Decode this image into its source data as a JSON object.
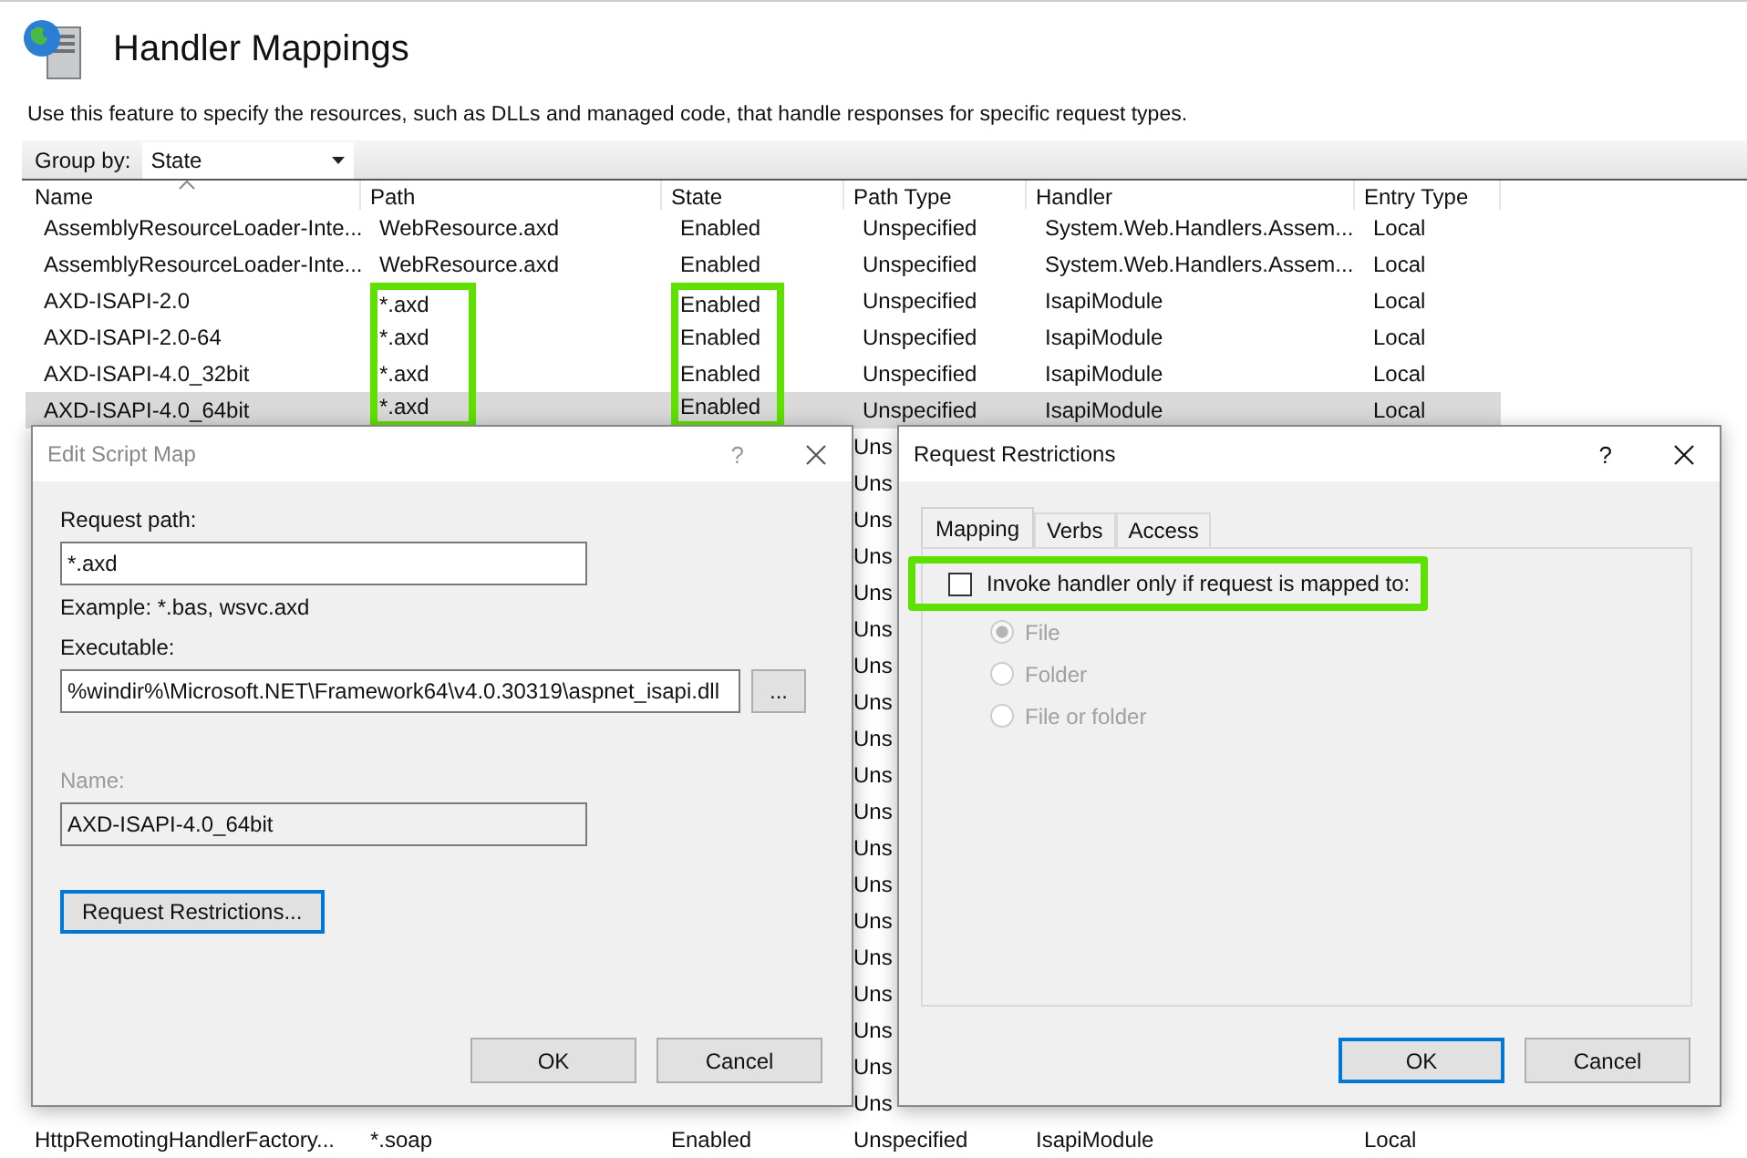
{
  "header": {
    "title": "Handler Mappings",
    "description": "Use this feature to specify the resources, such as DLLs and managed code, that handle responses for specific request types."
  },
  "group_by": {
    "label": "Group by:",
    "value": "State"
  },
  "table": {
    "columns": [
      {
        "label": "Name",
        "sorted": true
      },
      {
        "label": "Path",
        "sorted": false
      },
      {
        "label": "State",
        "sorted": false
      },
      {
        "label": "Path Type",
        "sorted": false
      },
      {
        "label": "Handler",
        "sorted": false
      },
      {
        "label": "Entry Type",
        "sorted": false
      }
    ],
    "rows": [
      {
        "cells": [
          {
            "text": "AssemblyResourceLoader-Inte...",
            "highlighted": false
          },
          {
            "text": "WebResource.axd",
            "highlighted": false
          },
          {
            "text": "Enabled",
            "highlighted": false
          },
          {
            "text": "Unspecified",
            "highlighted": false
          },
          {
            "text": "System.Web.Handlers.Assem...",
            "highlighted": false
          },
          {
            "text": "Local",
            "highlighted": false
          }
        ],
        "selected": false
      },
      {
        "cells": [
          {
            "text": "AssemblyResourceLoader-Inte...",
            "highlighted": false
          },
          {
            "text": "WebResource.axd",
            "highlighted": false
          },
          {
            "text": "Enabled",
            "highlighted": false
          },
          {
            "text": "Unspecified",
            "highlighted": false
          },
          {
            "text": "System.Web.Handlers.Assem...",
            "highlighted": false
          },
          {
            "text": "Local",
            "highlighted": false
          }
        ],
        "selected": false
      },
      {
        "cells": [
          {
            "text": "AXD-ISAPI-2.0",
            "highlighted": false
          },
          {
            "text": "*.axd",
            "highlighted": true
          },
          {
            "text": "Enabled",
            "highlighted": true
          },
          {
            "text": "Unspecified",
            "highlighted": false
          },
          {
            "text": "IsapiModule",
            "highlighted": false
          },
          {
            "text": "Local",
            "highlighted": false
          }
        ],
        "selected": false
      },
      {
        "cells": [
          {
            "text": "AXD-ISAPI-2.0-64",
            "highlighted": false
          },
          {
            "text": "*.axd",
            "highlighted": true
          },
          {
            "text": "Enabled",
            "highlighted": true
          },
          {
            "text": "Unspecified",
            "highlighted": false
          },
          {
            "text": "IsapiModule",
            "highlighted": false
          },
          {
            "text": "Local",
            "highlighted": false
          }
        ],
        "selected": false
      },
      {
        "cells": [
          {
            "text": "AXD-ISAPI-4.0_32bit",
            "highlighted": false
          },
          {
            "text": "*.axd",
            "highlighted": true
          },
          {
            "text": "Enabled",
            "highlighted": true
          },
          {
            "text": "Unspecified",
            "highlighted": false
          },
          {
            "text": "IsapiModule",
            "highlighted": false
          },
          {
            "text": "Local",
            "highlighted": false
          }
        ],
        "selected": false
      },
      {
        "cells": [
          {
            "text": "AXD-ISAPI-4.0_64bit",
            "highlighted": false
          },
          {
            "text": "*.axd",
            "highlighted": true
          },
          {
            "text": "Enabled",
            "highlighted": true
          },
          {
            "text": "Unspecified",
            "highlighted": false
          },
          {
            "text": "IsapiModule",
            "highlighted": false
          },
          {
            "text": "Local",
            "highlighted": false
          }
        ],
        "selected": true
      }
    ],
    "covered_row_fragments": [
      "Uns",
      "Uns",
      "Uns",
      "Uns",
      "Uns",
      "Uns",
      "Uns",
      "Uns",
      "Uns",
      "Uns",
      "Uns",
      "Uns",
      "Uns",
      "Uns",
      "Uns",
      "Uns",
      "Uns",
      "Uns",
      "Uns"
    ],
    "rows_below": [
      {
        "cells": [
          "HttpRemotingHandlerFactory...",
          "*.soap",
          "Enabled",
          "Unspecified",
          "IsapiModule",
          "Local"
        ],
        "selected": false
      }
    ]
  },
  "edit_dialog": {
    "title": "Edit Script Map",
    "active": false,
    "help": "?",
    "request_path": {
      "label": "Request path:",
      "value": "*.axd"
    },
    "example": "Example: *.bas, wsvc.axd",
    "executable": {
      "label": "Executable:",
      "value": "%windir%\\Microsoft.NET\\Framework64\\v4.0.30319\\aspnet_isapi.dll"
    },
    "browse_button": "...",
    "name": {
      "label": "Name:",
      "value": "AXD-ISAPI-4.0_64bit",
      "disabled": true
    },
    "restrictions_button": {
      "label": "Request Restrictions...",
      "focused": true
    },
    "buttons": [
      {
        "label": "OK",
        "focused": false
      },
      {
        "label": "Cancel",
        "focused": false
      }
    ]
  },
  "restrictions_dialog": {
    "title": "Request Restrictions",
    "active": true,
    "help": "?",
    "tabs": [
      {
        "label": "Mapping",
        "selected": true
      },
      {
        "label": "Verbs",
        "selected": false
      },
      {
        "label": "Access",
        "selected": false
      }
    ],
    "checkbox": {
      "label": "Invoke handler only if request is mapped to:",
      "checked": false,
      "highlighted": true
    },
    "radios": [
      {
        "label": "File",
        "selected": true,
        "disabled": true
      },
      {
        "label": "Folder",
        "selected": false,
        "disabled": true
      },
      {
        "label": "File or folder",
        "selected": false,
        "disabled": true
      }
    ],
    "buttons": [
      {
        "label": "OK",
        "focused": true
      },
      {
        "label": "Cancel",
        "focused": false
      }
    ]
  }
}
